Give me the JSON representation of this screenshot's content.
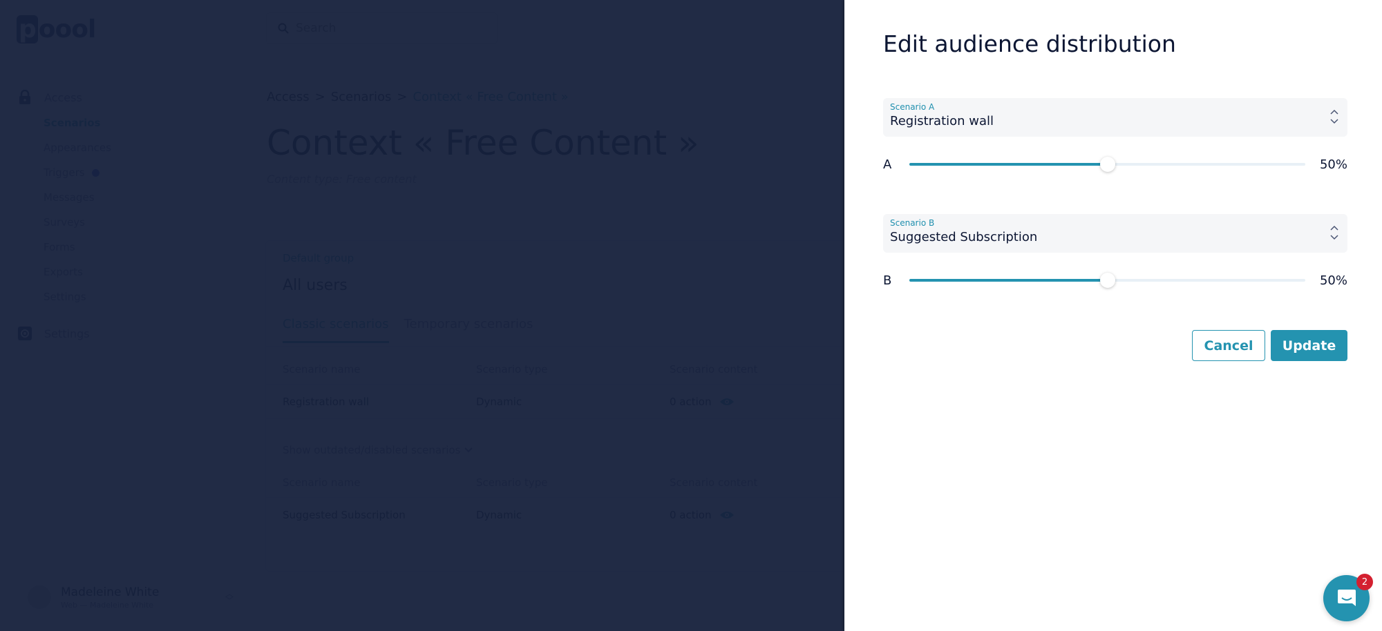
{
  "app": {
    "logo_text": "poool",
    "search": {
      "placeholder": "Search"
    },
    "sidebar": {
      "sections": [
        {
          "icon": "lock-icon",
          "label": "Access"
        },
        {
          "icon": "gear-icon",
          "label": "Settings"
        }
      ],
      "items": [
        {
          "label": "Scenarios",
          "active": true
        },
        {
          "label": "Appearances"
        },
        {
          "label": "Triggers",
          "dot": true
        },
        {
          "label": "Messages"
        },
        {
          "label": "Surveys"
        },
        {
          "label": "Forms"
        },
        {
          "label": "Exports"
        },
        {
          "label": "Settings"
        }
      ],
      "account": {
        "name": "Madeleine White",
        "sub": "Web — Madeleine White"
      }
    },
    "breadcrumb": [
      "Access",
      ">",
      "Scenarios",
      ">",
      "Context « Free Content »"
    ],
    "page_title": "Context « Free Content »",
    "page_subtitle": "Content type: Free content",
    "card": {
      "eyebrow": "Default group",
      "title": "All users",
      "tabs": [
        {
          "label": "Classic scenarios",
          "active": true
        },
        {
          "label": "Temporary scenarios"
        }
      ],
      "columns": [
        "Scenario name",
        "Scenario type",
        "Scenario content"
      ],
      "rows": [
        {
          "name": "Registration wall",
          "type": "Dynamic",
          "content": "0 action"
        }
      ],
      "show_more": "Show outdated/disabled scenarios",
      "outdated_rows": [
        {
          "name": "Suggested Subscription",
          "type": "Dynamic",
          "content": "0 action"
        }
      ]
    }
  },
  "drawer": {
    "title": "Edit audience distribution",
    "scenario_a": {
      "label": "Scenario A",
      "value": "Registration wall"
    },
    "slider_a": {
      "letter": "A",
      "percent": 50,
      "display": "50%"
    },
    "scenario_b": {
      "label": "Scenario B",
      "value": "Suggested Subscription"
    },
    "slider_b": {
      "letter": "B",
      "percent": 50,
      "display": "50%"
    },
    "cancel_label": "Cancel",
    "update_label": "Update"
  },
  "chat": {
    "badge_count": "2"
  },
  "colors": {
    "accent": "#2493b0",
    "text": "#0c1633",
    "badge": "#d42030",
    "overlay": "#16213c"
  }
}
